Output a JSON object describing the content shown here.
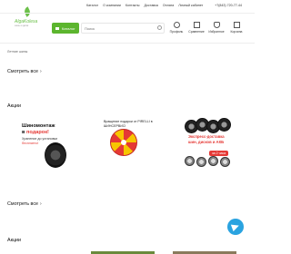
{
  "header": {
    "logo_name": "AlgaKolesa",
    "logo_tag": "шины и диски",
    "nav": [
      "Каталог",
      "О компании",
      "Контакты",
      "Доставка",
      "Оплата",
      "Личный кабинет"
    ],
    "phone": "+7(843) 720-77-44",
    "catalog_button": "Каталог",
    "search_placeholder": "Поиск",
    "icons": [
      {
        "label": "Профиль",
        "icon": "user-icon"
      },
      {
        "label": "Сравнение",
        "icon": "compare-icon"
      },
      {
        "label": "Избранное",
        "icon": "heart-icon"
      },
      {
        "label": "Корзина",
        "icon": "cart-icon"
      }
    ]
  },
  "breadcrumb": "Летние шины",
  "sections": {
    "see_all_1": "Смотреть все",
    "promo_1": "Акции",
    "see_all_2": "Смотреть все",
    "promo_2": "Акции"
  },
  "banners": {
    "b1": {
      "line1": "Шиномонтаж",
      "line2_prefix": "в ",
      "line2_red": "подарок!",
      "line3": "Хранение до установки",
      "line4": "бесплатно!"
    },
    "b2": {
      "line1": "Вращение подарки от PIRELLI в",
      "line2": "ШИНСЕРВИС!"
    },
    "b3": {
      "line1": "Экспресс-доставка",
      "line2": "шин, дисков и АКБ",
      "line3": "",
      "badge": "за 2 часа"
    }
  },
  "colors": {
    "accent": "#5cb52e",
    "red": "#e53935",
    "telegram": "#2aa3e0"
  }
}
